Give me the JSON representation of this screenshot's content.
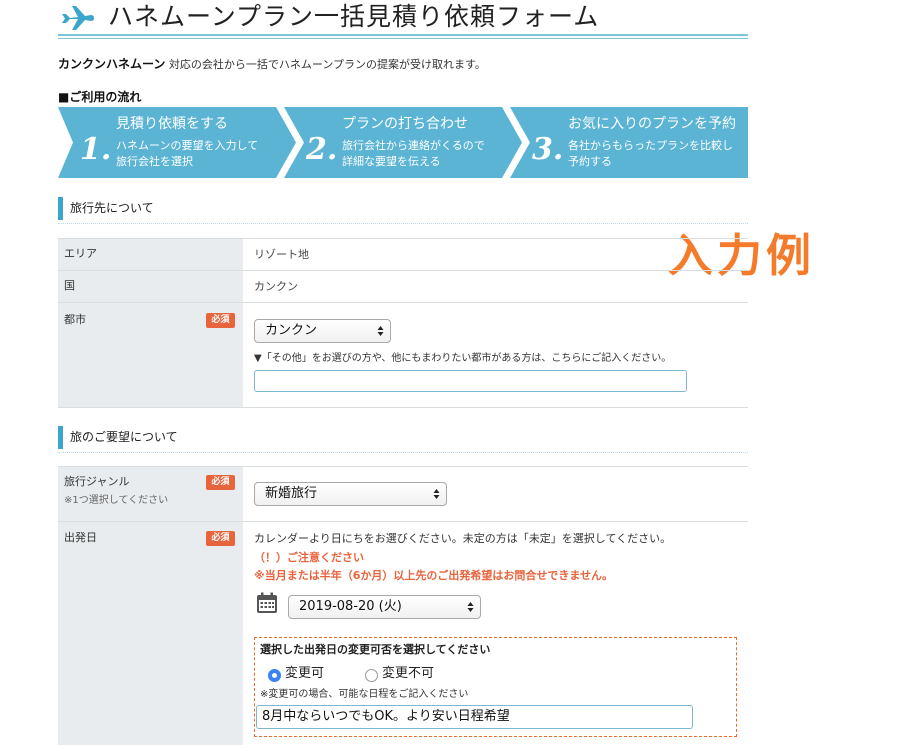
{
  "header": {
    "title": "ハネムーンプラン一括見積り依頼フォーム",
    "intro_bold": "カンクンハネムーン",
    "intro_text": "対応の会社から一括でハネムーンプランの提案が受け取れます。"
  },
  "flow": {
    "label": "■ご利用の流れ",
    "steps": [
      {
        "num": "1.",
        "title": "見積り依頼をする",
        "desc1": "ハネムーンの要望を入力して",
        "desc2": "旅行会社を選択"
      },
      {
        "num": "2.",
        "title": "プランの打ち合わせ",
        "desc1": "旅行会社から連絡がくるので",
        "desc2": "詳細な要望を伝える"
      },
      {
        "num": "3.",
        "title": "お気に入りのプランを予約",
        "desc1": "各社からもらったプランを比較し",
        "desc2": "予約する"
      }
    ],
    "color": "#5bb4d4"
  },
  "example_label": "入力例",
  "section1": {
    "title": "旅行先について",
    "area_label": "エリア",
    "area_value": "リゾート地",
    "country_label": "国",
    "country_value": "カンクン",
    "city_label": "都市",
    "required": "必須",
    "city_select": "カンクン",
    "city_note": "▼「その他」をお選びの方や、他にもまわりたい都市がある方は、こちらにご記入ください。",
    "city_input_value": ""
  },
  "section2": {
    "title": "旅のご要望について",
    "genre_label": "旅行ジャンル",
    "genre_sub": "※1つ選択してください",
    "required": "必須",
    "genre_select": "新婚旅行",
    "date_label": "出発日",
    "date_note": "カレンダーより日にちをお選びください。未定の方は「未定」を選択してください。",
    "warn1": "（！）ご注意ください",
    "warn2": "※当月または半年（6か月）以上先のご出発希望はお問合せできません。",
    "date_select": "2019-08-20 (火)",
    "change_title": "選択した出発日の変更可否を選択してください",
    "radio_yes": "変更可",
    "radio_no": "変更不可",
    "radio_selected": "変更可",
    "change_note": "※変更可の場合、可能な日程をご記入ください",
    "change_input_value": "8月中ならいつでもOK。より安い日程希望"
  },
  "colors": {
    "accent": "#3ba6cc",
    "required_badge": "#e8643c",
    "example_text": "#f47b2a",
    "label_cell": "#e8ecef"
  },
  "icons": [
    "airplane-icon",
    "calendar-icon",
    "select-arrow-icon"
  ]
}
